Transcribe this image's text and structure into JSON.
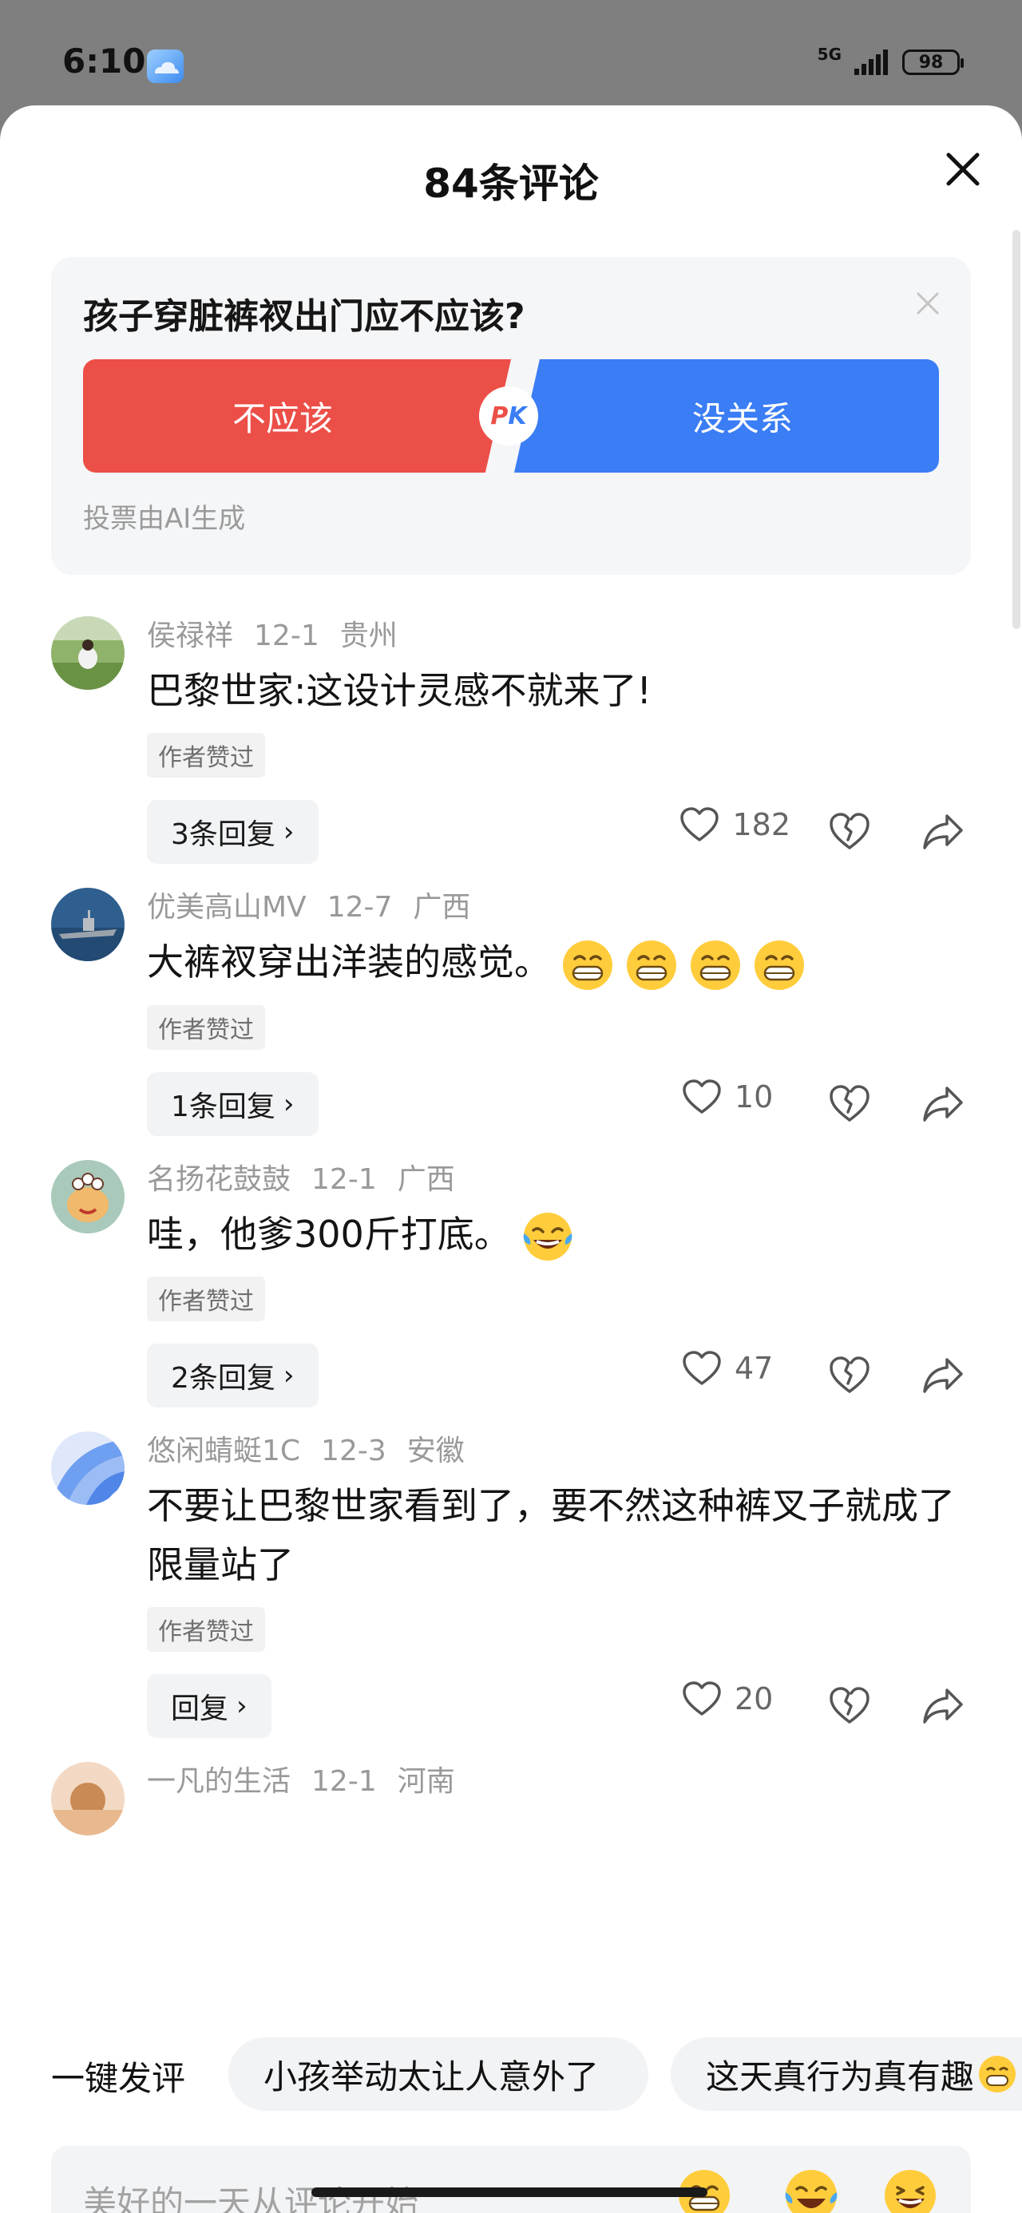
{
  "status_bar": {
    "time": "6:10",
    "network": "5G",
    "battery": "98"
  },
  "sheet": {
    "title": "84条评论"
  },
  "poll": {
    "question": "孩子穿脏裤衩出门应不应该?",
    "option_left": "不应该",
    "option_right": "没关系",
    "pk_left": "P",
    "pk_right": "K",
    "note": "投票由AI生成",
    "colors": {
      "left": "#ec4f47",
      "right": "#3a7df5"
    }
  },
  "comments": [
    {
      "user": "侯禄祥",
      "date": "12-1",
      "location": "贵州",
      "text": "巴黎世家:这设计灵感不就来了!",
      "author_liked": "作者赞过",
      "replies": "3条回复",
      "likes": "182",
      "emoji_count": 0
    },
    {
      "user": "优美高山MV",
      "date": "12-7",
      "location": "广西",
      "text": "大裤衩穿出洋装的感觉。",
      "author_liked": "作者赞过",
      "replies": "1条回复",
      "likes": "10",
      "emoji_count": 4
    },
    {
      "user": "名扬花鼓鼓",
      "date": "12-1",
      "location": "广西",
      "text": "哇，他爹300斤打底。",
      "author_liked": "作者赞过",
      "replies": "2条回复",
      "likes": "47",
      "emoji_count": 1
    },
    {
      "user": "悠闲蜻蜓1C",
      "date": "12-3",
      "location": "安徽",
      "text": "不要让巴黎世家看到了，要不然这种裤叉子就成了限量站了",
      "author_liked": "作者赞过",
      "replies": "回复",
      "likes": "20",
      "emoji_count": 0
    },
    {
      "user": "一凡的生活",
      "date": "12-1",
      "location": "河南",
      "text": "",
      "author_liked": "",
      "replies": "",
      "likes": "",
      "emoji_count": 0
    }
  ],
  "quick_comment": {
    "label": "一键发评",
    "chips": [
      "小孩举动太让人意外了",
      "这天真行为真有趣"
    ]
  },
  "input": {
    "placeholder": "美好的一天从评论开始"
  },
  "icons": [
    "weather-icon",
    "signal-icon",
    "battery-icon",
    "close-icon",
    "heart-icon",
    "broken-heart-icon",
    "share-icon",
    "grin-emoji",
    "laugh-cry-emoji"
  ]
}
